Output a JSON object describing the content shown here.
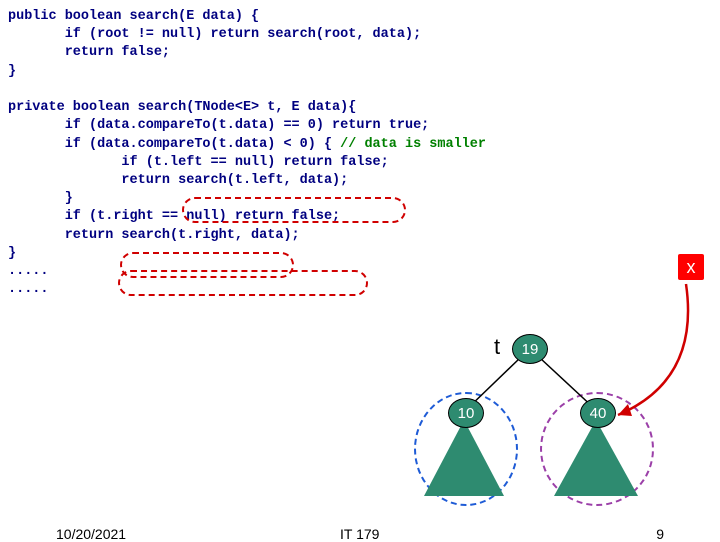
{
  "code": {
    "l1": "public boolean search(E data) {",
    "l2": "       if (root != null) return search(root, data);",
    "l3": "       return false;",
    "l4": "}",
    "l5": "",
    "l6": "private boolean search(TNode<E> t, E data){",
    "l7": "       if (data.compareTo(t.data) == 0) return true;",
    "l8a": "       if (data.compareTo(t.data) < 0) { ",
    "l8b": "// data is smaller",
    "l9": "              if (t.left == null) return false;",
    "l10": "              return search(t.left, data);",
    "l11": "       }",
    "l12": "       if (t.right == null) return false;",
    "l13": "       return search(t.right, data);",
    "l14": "}",
    "l15": ".....",
    "l16": "....."
  },
  "tree": {
    "root_label": "19",
    "left_label": "10",
    "right_label": "40",
    "t_label": "t",
    "x_label": "x"
  },
  "footer": {
    "date": "10/20/2021",
    "course": "IT 179",
    "page": "9"
  },
  "chart_data": {
    "type": "diagram",
    "description": "Binary search tree snippet illustration",
    "nodes": [
      {
        "id": "root",
        "value": 19,
        "pointer": "t"
      },
      {
        "id": "left",
        "value": 10,
        "parent": "root",
        "side": "left"
      },
      {
        "id": "right",
        "value": 40,
        "parent": "root",
        "side": "right"
      }
    ],
    "marker": "x"
  }
}
